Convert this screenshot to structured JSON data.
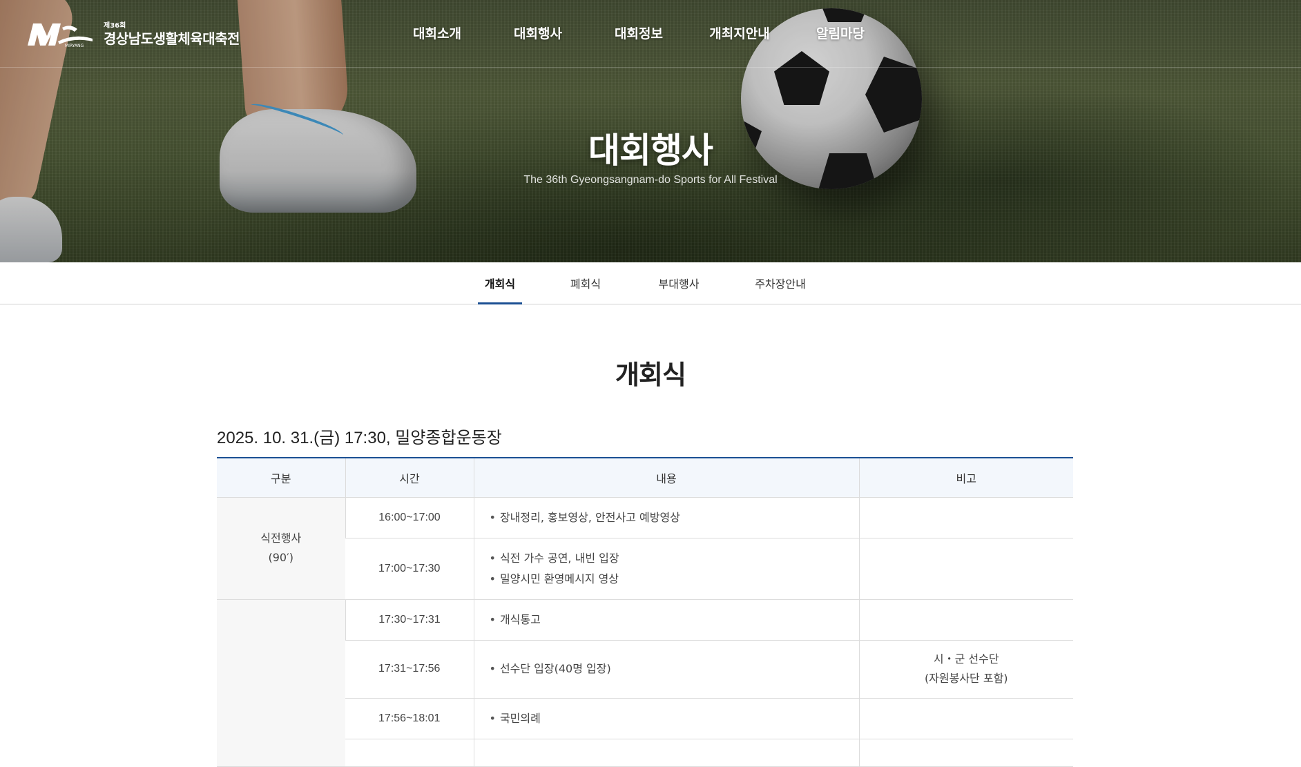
{
  "header": {
    "logo_small": "제36회",
    "logo_name": "경상남도생활체육대축전",
    "logo_mark_text": "MIRYANG",
    "nav": [
      "대회소개",
      "대회행사",
      "대회정보",
      "개최지안내",
      "알림마당"
    ]
  },
  "hero": {
    "title": "대회행사",
    "subtitle": "The 36th Gyeongsangnam-do Sports for All Festival"
  },
  "tabs": [
    {
      "label": "개회식",
      "active": true
    },
    {
      "label": "폐회식",
      "active": false
    },
    {
      "label": "부대행사",
      "active": false
    },
    {
      "label": "주차장안내",
      "active": false
    }
  ],
  "main": {
    "title": "개회식",
    "event_info": "2025. 10. 31.(금) 17:30, 밀양종합운동장",
    "table": {
      "headers": [
        "구분",
        "시간",
        "내용",
        "비고"
      ],
      "group1_label": "식전행사",
      "group1_sub": "(90′)",
      "rows": [
        {
          "time": "16:00~17:00",
          "content": [
            "장내정리, 홍보영상, 안전사고 예방영상"
          ],
          "note": [
            "",
            ""
          ]
        },
        {
          "time": "17:00~17:30",
          "content": [
            "식전 가수 공연, 내빈 입장",
            "밀양시민 환영메시지 영상"
          ],
          "note": [
            "",
            ""
          ]
        },
        {
          "time": "17:30~17:31",
          "content": [
            "개식통고"
          ],
          "note": [
            "",
            ""
          ]
        },
        {
          "time": "17:31~17:56",
          "content": [
            "선수단 입장(40명 입장)"
          ],
          "note": [
            "시・군 선수단",
            "(자원봉사단 포함)"
          ]
        },
        {
          "time": "17:56~18:01",
          "content": [
            "국민의례"
          ],
          "note": [
            "",
            ""
          ]
        }
      ]
    }
  },
  "colors": {
    "accent": "#1a4f93",
    "header_bg": "#f3f7fc",
    "border": "#dcdcdc"
  }
}
